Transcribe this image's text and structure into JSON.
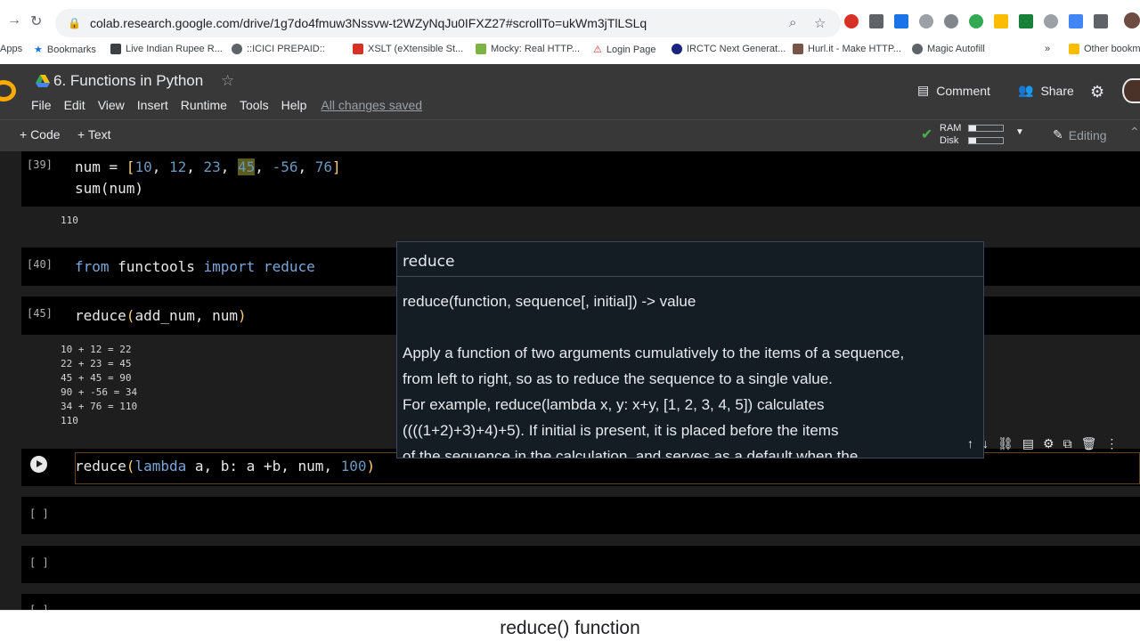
{
  "browser": {
    "url": "colab.research.google.com/drive/1g7do4fmuw3Nssvw-t2WZyNqJu0IFXZ27#scrollTo=ukWm3jTlLSLq",
    "bookmarks": [
      "Apps",
      "Bookmarks",
      "Live Indian Rupee R...",
      "::ICICI PREPAID::",
      "XSLT (eXtensible St...",
      "Mocky: Real HTTP...",
      "Login Page",
      "IRCTC Next Generat...",
      "Hurl.it - Make HTTP...",
      "Magic Autofill",
      "»",
      "Other bookm"
    ]
  },
  "header": {
    "title": "6. Functions in Python",
    "menu": [
      "File",
      "Edit",
      "View",
      "Insert",
      "Runtime",
      "Tools",
      "Help"
    ],
    "saved_status": "All changes saved",
    "comment_label": "Comment",
    "share_label": "Share"
  },
  "toolbar": {
    "add_code": "+ Code",
    "add_text": "+ Text",
    "ram_label": "RAM",
    "disk_label": "Disk",
    "ram_usage": 0.2,
    "disk_usage": 0.2,
    "editing_label": "Editing"
  },
  "cells": {
    "c39": {
      "num": "[39]",
      "line1_a": "num = ",
      "line1_b": "[",
      "line1_nums": [
        "10",
        "12",
        "23"
      ],
      "line1_hl": "45",
      "line1_c": "-56",
      "line1_d": "76",
      "line1_end": "]",
      "line2": "sum(num)",
      "output": "110"
    },
    "c40": {
      "num": "[40]",
      "kw_from": "from",
      "module": " functools ",
      "kw_import": "import",
      "name": " reduce"
    },
    "c45": {
      "num": "[45]",
      "code_a": "reduce",
      "code_b": "(",
      "code_c": "add_num, num",
      "code_d": ")",
      "output_lines": [
        "10 + 12 = 22",
        "22 + 23 = 45",
        "45 + 45 = 90",
        "90 + -56 = 34",
        "34 + 76 = 110",
        "110"
      ]
    },
    "active": {
      "code_a": "reduce",
      "code_b": "(",
      "code_kw": "lambda",
      "code_c": " a, b: a +b, num, ",
      "code_num": "100",
      "code_end": ")"
    },
    "empty1": "[ ]",
    "empty2": "[ ]",
    "empty3": "[ ]"
  },
  "tooltip": {
    "title": "reduce",
    "signature": "reduce(function, sequence[, initial]) -> value",
    "lines": [
      "Apply a function of two arguments cumulatively to the items of a sequence,",
      "from left to right, so as to reduce the sequence to a single value.",
      "For example, reduce(lambda x, y: x+y, [1, 2, 3, 4, 5]) calculates",
      "((((1+2)+3)+4)+5).  If initial is present, it is placed before the items",
      "of the sequence in the calculation, and serves as a default when the"
    ]
  },
  "caption": "reduce() function"
}
